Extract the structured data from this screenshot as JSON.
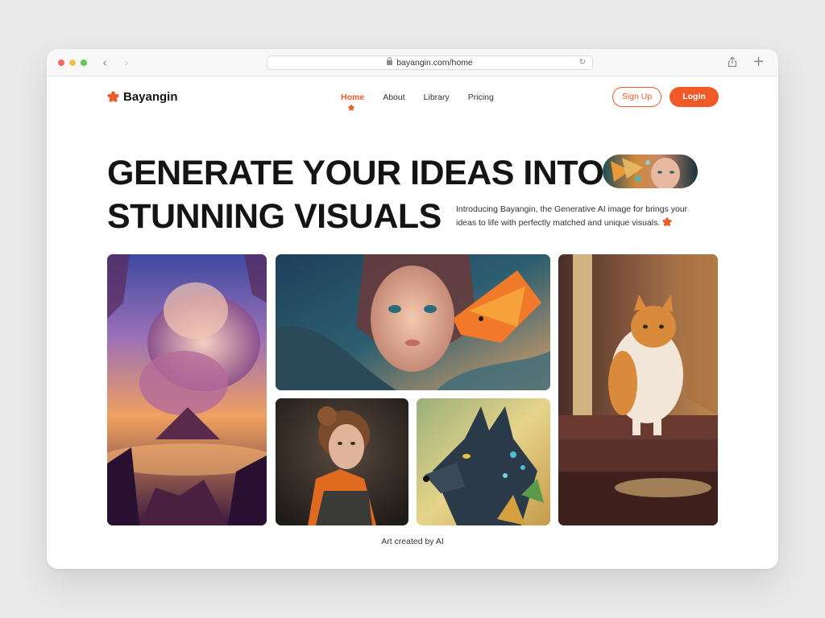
{
  "browser": {
    "url": "bayangin.com/home"
  },
  "brand": {
    "name": "Bayangin",
    "accent_color": "#f05a28"
  },
  "nav": {
    "items": [
      {
        "label": "Home",
        "active": true
      },
      {
        "label": "About",
        "active": false
      },
      {
        "label": "Library",
        "active": false
      },
      {
        "label": "Pricing",
        "active": false
      }
    ]
  },
  "auth": {
    "signup_label": "Sign Up",
    "login_label": "Login"
  },
  "hero": {
    "line1": "GENERATE YOUR IDEAS INTO",
    "line2": "STUNNING VISUALS",
    "intro": "Introducing Bayangin, the Generative AI image for brings your ideas to life with perfectly matched and unique visuals."
  },
  "gallery": {
    "images": [
      {
        "name": "volcano-landscape"
      },
      {
        "name": "girl-with-fire-bird"
      },
      {
        "name": "girl-portrait"
      },
      {
        "name": "wolf-portrait"
      },
      {
        "name": "cat-on-stairs"
      }
    ],
    "caption": "Art created by AI"
  }
}
